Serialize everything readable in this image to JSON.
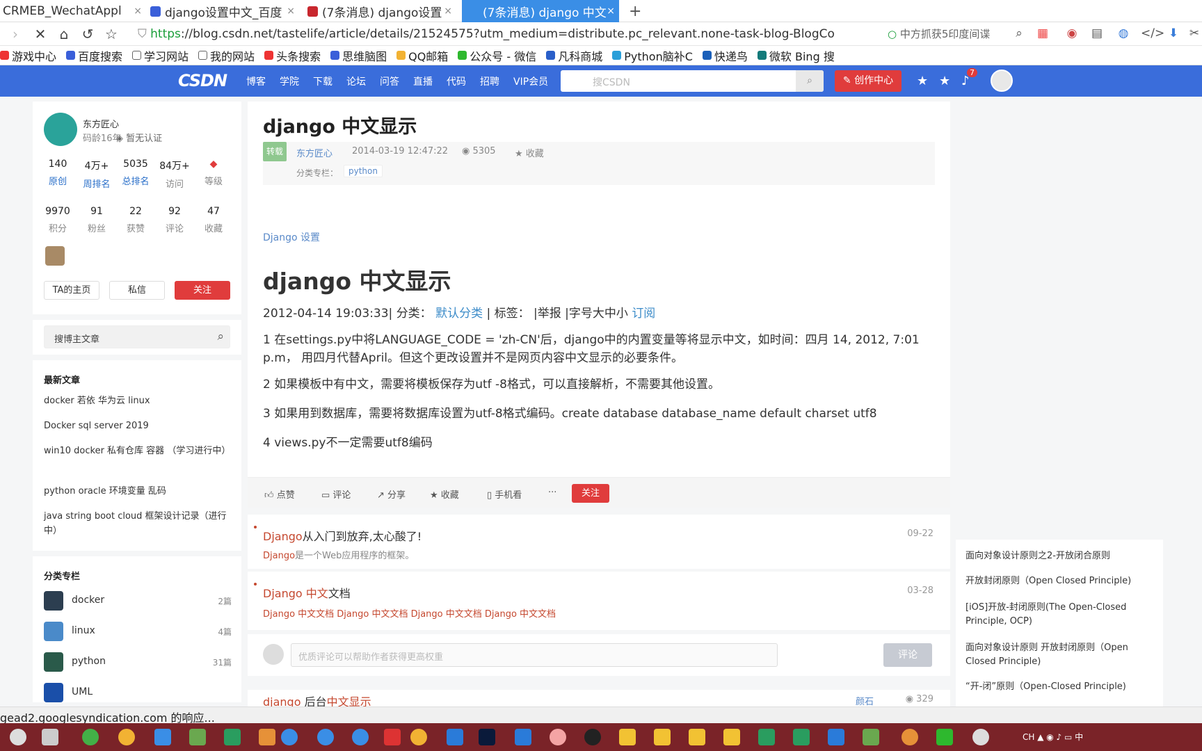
{
  "tabs": [
    {
      "title": "CRMEB_WechatAppl",
      "x": "×"
    },
    {
      "title": "django设置中文_百度",
      "x": "×"
    },
    {
      "title": "(7条消息) django设置",
      "x": "×"
    },
    {
      "title": "(7条消息) django 中文",
      "x": "×"
    }
  ],
  "new_tab": "+",
  "address": {
    "protocol": "https",
    "url_rest": "://blog.csdn.net/tastelife/article/details/21524575?utm_medium=distribute.pc_relevant.none-task-blog-BlogCo",
    "search_hint": "中方抓获5印度间谍"
  },
  "bookmarks": [
    "游戏中心",
    "百度搜索",
    "学习网站",
    "我的网站",
    "头条搜索",
    "思维脑图",
    "QQ邮箱",
    "公众号 - 微信",
    "凡科商城",
    "Python脑补C",
    "快递鸟",
    "微软 Bing 搜"
  ],
  "csdn": {
    "logo": "CSDN",
    "nav": [
      "博客",
      "学院",
      "下载",
      "论坛",
      "问答",
      "直播",
      "代码",
      "招聘",
      "VIP会员"
    ],
    "search_placeholder": "搜CSDN",
    "create": "创作中心",
    "notif_count": "7"
  },
  "profile": {
    "name": "东方匠心",
    "age": "码龄16年",
    "cert": "暂无认证",
    "stats1": [
      {
        "v": "140",
        "l": "原创"
      },
      {
        "v": "4万+",
        "l": "周排名"
      },
      {
        "v": "5035",
        "l": "总排名"
      },
      {
        "v": "84万+",
        "l": "访问"
      },
      {
        "v": "",
        "l": "等级"
      }
    ],
    "stats2": [
      {
        "v": "9970",
        "l": "积分"
      },
      {
        "v": "91",
        "l": "粉丝"
      },
      {
        "v": "22",
        "l": "获赞"
      },
      {
        "v": "92",
        "l": "评论"
      },
      {
        "v": "47",
        "l": "收藏"
      }
    ],
    "btn_home": "TA的主页",
    "btn_msg": "私信",
    "btn_follow": "关注"
  },
  "side_search": "搜博主文章",
  "recent": {
    "title": "最新文章",
    "items": [
      "docker 若依 华为云 linux",
      "Docker sql server 2019",
      "win10 docker 私有仓库 容器 （学习进行中）",
      "python oracle 环境变量 乱码",
      "java string boot cloud 框架设计记录（进行中）"
    ]
  },
  "categories": {
    "title": "分类专栏",
    "items": [
      {
        "name": "docker",
        "count": "2篇"
      },
      {
        "name": "linux",
        "count": "4篇"
      },
      {
        "name": "python",
        "count": "31篇"
      },
      {
        "name": "UML",
        "count": ""
      }
    ]
  },
  "article": {
    "title": "django 中文显示",
    "repost": "转载",
    "author": "东方匠心",
    "date": "2014-03-19 12:47:22",
    "views": "5305",
    "collect": "收藏",
    "cat_label": "分类专栏：",
    "tag": "python",
    "setting_link": "Django 设置",
    "h2": "django 中文显示",
    "date_line": {
      "date": "2012-04-14 19:03:33|",
      "cat": "分类：",
      "cat_link": "默认分类",
      "rest": "|   标签：   |举报 |字号大中小",
      "sub": "订阅"
    },
    "paras": [
      "1 在settings.py中将LANGUAGE_CODE = 'zh-CN'后，django中的内置变量等将显示中文，如时间：四月 14, 2012, 7:01 p.m， 用四月代替April。但这个更改设置并不是网页内容中文显示的必要条件。",
      "2 如果模板中有中文，需要将模板保存为utf -8格式，可以直接解析，不需要其他设置。",
      "3 如果用到数据库，需要将数据库设置为utf-8格式编码。create database database_name default charset utf8",
      "4 views.py不一定需要utf8编码"
    ]
  },
  "actions": [
    "点赞",
    "评论",
    "分享",
    "收藏",
    "手机看",
    "···",
    "关注"
  ],
  "related": [
    {
      "t1": "Django",
      "t2": "从入门到放弃,太心酸了!",
      "date": "09-22",
      "s1": "Django",
      "s2": "是一个Web应用程序的框架。"
    },
    {
      "t1": "Django 中文",
      "t2": "文档",
      "date": "03-28",
      "sub": "Django 中文文档 Django 中文文档 Django 中文文档 Django 中文文档"
    }
  ],
  "comment": {
    "placeholder": "优质评论可以帮助作者获得更高权重",
    "btn": "评论"
  },
  "rel3": {
    "t1": "django ",
    "t2": "后台",
    "t3": "中文显示",
    "author": "颜石",
    "views": "329"
  },
  "right_rec": [
    "面向对象设计原则之2-开放闭合原则",
    "开放封闭原则（Open Closed Principle)",
    "[iOS]开放-封闭原则(The Open-Closed Principle, OCP)",
    "面向对象设计原则 开放封闭原则（Open Closed Principle)",
    "“开-闭”原则（Open-Closed Principle)"
  ],
  "status": "gead2.googlesyndication.com 的响应..."
}
